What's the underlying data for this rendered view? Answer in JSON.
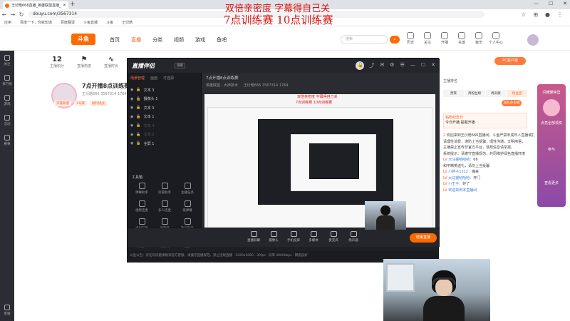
{
  "browser": {
    "tab_title": "王衍皓666直播_英雄联盟直播_...",
    "url": "douyu.com/3567314",
    "bookmarks": [
      "应用",
      "百度一下，你就知道",
      "百度翻译",
      "斗鱼直播",
      "斗鱼",
      "王衍皓"
    ]
  },
  "captions": {
    "line1": "双倍亲密度 字幕得自己关",
    "line2": "7点训练赛   10点训练赛"
  },
  "douyu": {
    "logo": "斗鱼",
    "nav": [
      "首页",
      "直播",
      "分类",
      "视频",
      "游戏",
      "鱼吧"
    ],
    "nav_active": 1,
    "search_placeholder": "搜索",
    "header_icons": [
      "历史",
      "关注",
      "开播",
      "充值",
      "鱼乐",
      "个人中心"
    ],
    "rail": [
      "关注",
      "排行榜",
      "游戏",
      "活动",
      "赛事",
      "客服"
    ],
    "stats": [
      {
        "value": "12",
        "label": "主播积分"
      },
      {
        "value": "",
        "label": "直播热度"
      },
      {
        "value": "",
        "label": "直播时长"
      }
    ],
    "room_title": "7点开播8点训练赛",
    "room_meta": "王衍皓666  3567314  1764",
    "room_tags": [
      "英雄联盟",
      "1号城",
      "福利挑战"
    ],
    "pc_button": "PC客户端",
    "rp_head": "主播排名",
    "rp_tabs": [
      "贵宾",
      "周粉丝榜",
      "周贡献",
      "粉丝团"
    ],
    "gift_button": "送礼办主播",
    "notice_title": "钻粉纪念日",
    "notice_text": "今日开播 提醒开播",
    "promo": [
      "闪耀聚焦营",
      "点亮全部领奖",
      "参与",
      "查看更多"
    ]
  },
  "chat": [
    {
      "tag": "2",
      "name": "",
      "text": "欢迎来到王衍皓666直播间，斗鱼严禁未成年人直播或打赏，"
    },
    {
      "tag": "",
      "name": "",
      "text": "请理性消费，谨防上当受骗，理性沟通，文明用语，"
    },
    {
      "tag": "",
      "name": "",
      "text": "主播禁止宣传非官方平台，违规信息请举报。"
    },
    {
      "tag": "",
      "name": "",
      "text": "系统提示：请遵守直播规范，共同维护绿色直播环境"
    },
    {
      "tag": "LV",
      "name": "大马猴哈哈哈：",
      "text": "66"
    },
    {
      "tag": "",
      "name": "",
      "text": "和平精英送礼，请勿上当受骗"
    },
    {
      "tag": "LV",
      "name": "小胖子1212：",
      "text": "嗨来"
    },
    {
      "tag": "LV",
      "name": "大马猴哈哈哈：",
      "text": "开门"
    },
    {
      "tag": "LV",
      "name": "小王子：",
      "text": "好了"
    },
    {
      "tag": "LV",
      "name": "欢迎来到本直播间",
      "text": ""
    }
  ],
  "obs": {
    "logo": "直播伴侣",
    "version": "旗舰",
    "left_tabs": [
      "场景管理",
      "画面",
      "可选源"
    ],
    "sources": [
      {
        "label": "文本 3",
        "dim": false
      },
      {
        "label": "摄像头 1",
        "dim": false
      },
      {
        "label": "文本 3",
        "dim": false
      },
      {
        "label": "文本 1",
        "dim": false
      },
      {
        "label": "文本 4",
        "dim": true
      },
      {
        "label": "文本 2",
        "dim": true
      },
      {
        "label": "全屏 1",
        "dim": false
      }
    ],
    "tools_title": "工具箱",
    "tools": [
      "弹幕助手",
      "房管助手",
      "主播任务",
      "视频连麦",
      "多人连麦",
      "接弹幕",
      "虚拟形象",
      "弹幕姬",
      "歌词助手",
      "美颜",
      "小游戏",
      "更多"
    ],
    "stage_title": "7点开播8点训练赛",
    "stage_sub": "英雄联盟 · 大神技术",
    "stage_id": "王衍皓666  3567314  1764",
    "bottom_tools": [
      "直播屏幕",
      "摄像头",
      "手机投屏",
      "多媒体",
      "麦克风",
      "扬声器"
    ],
    "go_live": "结束直播",
    "foot": "斗鱼公告：有任何问题请联系官方客服，请遵守直播规范，禁止违规直播 · 1920x1080 · 30fps · 码率 4000kbps · 网络良好"
  },
  "inner_captions": {
    "line1": "双倍亲密度 字幕得自己关",
    "line2": "7点训练赛   10点训练赛"
  }
}
